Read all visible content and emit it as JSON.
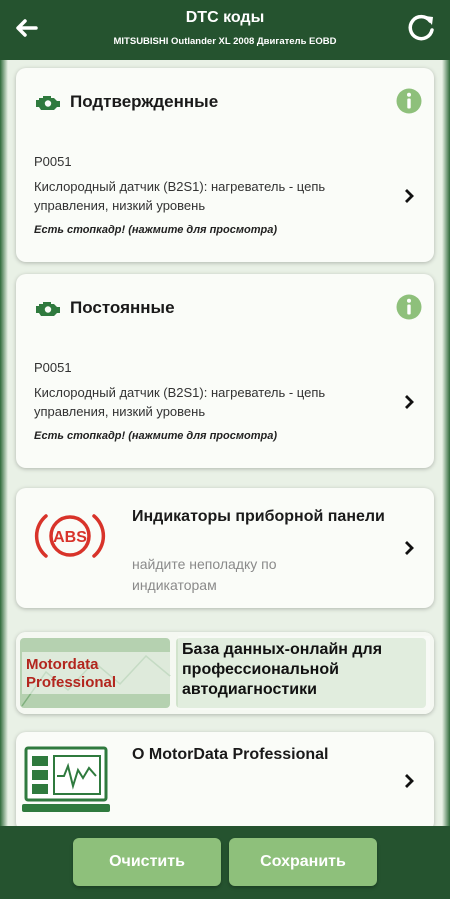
{
  "header": {
    "title": "DTC коды",
    "subtitle": "MITSUBISHI Outlander XL 2008 Двигатель EOBD",
    "back_icon": "arrow-left-icon",
    "refresh_icon": "refresh-icon"
  },
  "confirmed": {
    "title": "Подтвержденные",
    "code": "P0051",
    "description": "Кислородный датчик (B2S1): нагреватель - цепь управления, низкий уровень",
    "freeze_frame": "Есть стопкадр! (нажмите для просмотра)"
  },
  "permanent": {
    "title": "Постоянные",
    "code": "P0051",
    "description": "Кислородный датчик (B2S1): нагреватель - цепь управления, низкий уровень",
    "freeze_frame": "Есть стопкадр! (нажмите для просмотра)"
  },
  "indicators": {
    "title": "Индикаторы приборной панели",
    "subtitle": "найдите неполадку по индикаторам",
    "icon_label": "ABS"
  },
  "banner": {
    "brand": "Motordata Professional",
    "text": "База данных-онлайн для профессиональной автодиагностики"
  },
  "about": {
    "title": "О MotorData Professional"
  },
  "footer": {
    "clear_label": "Очистить",
    "save_label": "Сохранить"
  },
  "colors": {
    "header_bg": "#25532f",
    "button_bg": "#8ec07b",
    "info_icon": "#8ec07b",
    "icon_green": "#2f7a3e",
    "abs_red": "#d8332a"
  }
}
